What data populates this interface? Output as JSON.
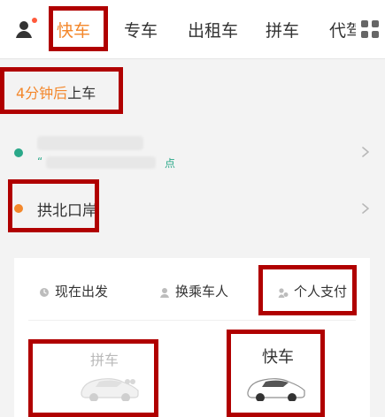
{
  "topnav": {
    "tabs": [
      {
        "label": "快车"
      },
      {
        "label": "专车"
      },
      {
        "label": "出租车"
      },
      {
        "label": "拼车"
      },
      {
        "label": "代驾"
      }
    ],
    "user_icon": "user-icon",
    "grid_icon": "grid-icon",
    "accent_color": "#f3872b"
  },
  "eta": {
    "minutes": "4分钟后",
    "action": "上车"
  },
  "pickup": {
    "name": "",
    "hint_prefix": "“",
    "hint_suffix": "点"
  },
  "dropoff": {
    "name": "拱北口岸"
  },
  "ride_options": [
    {
      "label": "现在出发",
      "icon": "clock-icon"
    },
    {
      "label": "换乘车人",
      "icon": "person-icon"
    },
    {
      "label": "个人支付",
      "icon": "payment-icon"
    }
  ],
  "car_types": [
    {
      "label": "拼车",
      "icon": "car-icon",
      "state": "dim"
    },
    {
      "label": "快车",
      "icon": "car-icon",
      "state": "active"
    }
  ],
  "colors": {
    "pickup_dot": "#2aa889",
    "dropoff_dot": "#f3872b",
    "highlight": "#b00000"
  }
}
